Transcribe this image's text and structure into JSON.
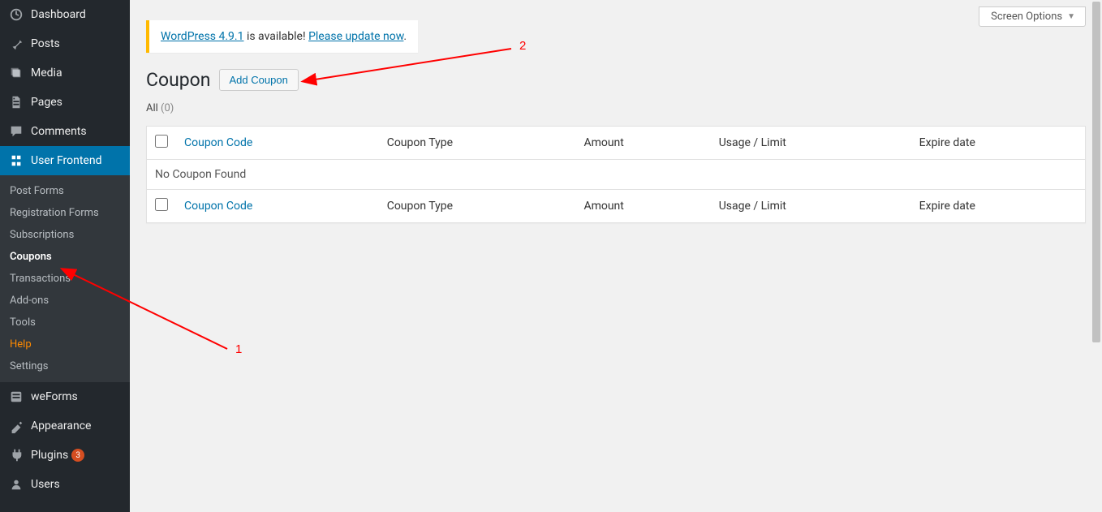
{
  "sidebar": {
    "main": [
      {
        "icon": "dashboard",
        "label": "Dashboard"
      },
      {
        "icon": "pin",
        "label": "Posts"
      },
      {
        "icon": "media",
        "label": "Media"
      },
      {
        "icon": "page",
        "label": "Pages"
      },
      {
        "icon": "comments",
        "label": "Comments"
      },
      {
        "icon": "user-frontend",
        "label": "User Frontend",
        "current": true
      }
    ],
    "sub": [
      {
        "label": "Post Forms"
      },
      {
        "label": "Registration Forms"
      },
      {
        "label": "Subscriptions"
      },
      {
        "label": "Coupons",
        "active": true
      },
      {
        "label": "Transactions"
      },
      {
        "label": "Add-ons"
      },
      {
        "label": "Tools"
      },
      {
        "label": "Help",
        "help": true
      },
      {
        "label": "Settings"
      }
    ],
    "after": [
      {
        "icon": "weforms",
        "label": "weForms"
      },
      {
        "icon": "appearance",
        "label": "Appearance"
      },
      {
        "icon": "plugins",
        "label": "Plugins",
        "badge": "3"
      },
      {
        "icon": "users",
        "label": "Users"
      }
    ]
  },
  "screen_options_label": "Screen Options",
  "notice": {
    "link1_text": "WordPress 4.9.1",
    "mid_text": " is available! ",
    "link2_text": "Please update now"
  },
  "page_title": "Coupon",
  "add_button": "Add Coupon",
  "filter": {
    "all_label": "All",
    "count": "(0)"
  },
  "table": {
    "headers": {
      "code": "Coupon Code",
      "type": "Coupon Type",
      "amount": "Amount",
      "usage": "Usage / Limit",
      "expire": "Expire date"
    },
    "empty_text": "No Coupon Found"
  },
  "annotation": {
    "l1": "1",
    "l2": "2"
  }
}
